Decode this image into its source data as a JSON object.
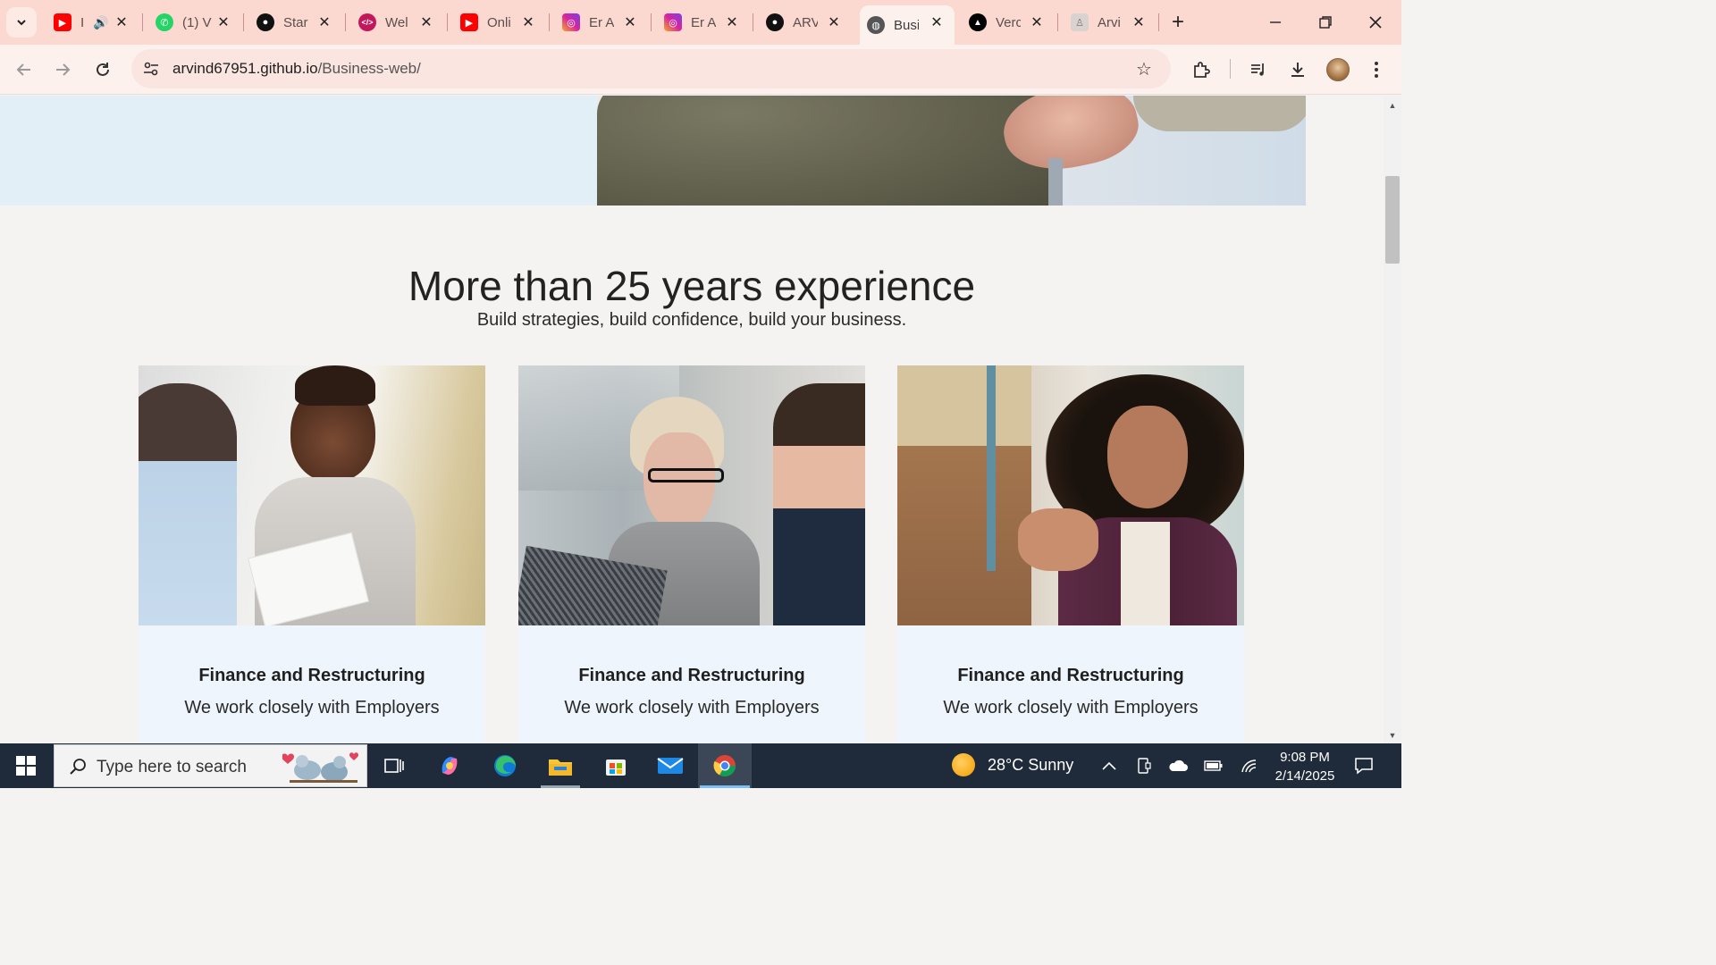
{
  "browser": {
    "tabs": [
      {
        "title": "I",
        "icon": "youtube-icon",
        "color": "#ff0000",
        "close": "✕"
      },
      {
        "title": "(1) V",
        "icon": "whatsapp-icon",
        "color": "#25d366",
        "close": "✕"
      },
      {
        "title": "Star",
        "icon": "github-icon",
        "color": "#111111",
        "close": "✕"
      },
      {
        "title": "Wel",
        "icon": "code-icon",
        "color": "#c2185b",
        "close": "✕"
      },
      {
        "title": "Onli",
        "icon": "youtube-icon",
        "color": "#ff0000",
        "close": "✕"
      },
      {
        "title": "Er A",
        "icon": "instagram-icon",
        "color": "#d6249f",
        "close": "✕"
      },
      {
        "title": "Er A",
        "icon": "instagram-icon",
        "color": "#d6249f",
        "close": "✕"
      },
      {
        "title": "ARV",
        "icon": "github-icon",
        "color": "#111111",
        "close": "✕"
      },
      {
        "title": "Busi",
        "icon": "globe-icon",
        "color": "#555555",
        "close": "✕",
        "active": true
      },
      {
        "title": "Verc",
        "icon": "vercel-icon",
        "color": "#000000",
        "close": "✕"
      },
      {
        "title": "Arvi",
        "icon": "person-icon",
        "color": "#8b8b8b",
        "close": "✕"
      }
    ],
    "url_host": "arvind67951.github.io",
    "url_path": "/Business-web/"
  },
  "page": {
    "section_title": "More than 25 years experience",
    "section_subtitle": "Build strategies, build confidence, build your business.",
    "cards": [
      {
        "title": "Finance and Restructuring",
        "text": "We work closely with Employers"
      },
      {
        "title": "Finance and Restructuring",
        "text": "We work closely with Employers"
      },
      {
        "title": "Finance and Restructuring",
        "text": "We work closely with Employers"
      }
    ]
  },
  "taskbar": {
    "search_placeholder": "Type here to search",
    "weather": "28°C  Sunny",
    "time": "9:08 PM",
    "date": "2/14/2025"
  },
  "colors": {
    "tabstrip": "#fbd9d1",
    "toolbar": "#fdf1ee",
    "page_bg": "#f5f3f1",
    "card_bg": "#eef5fc",
    "taskbar": "#1f2a3a"
  }
}
